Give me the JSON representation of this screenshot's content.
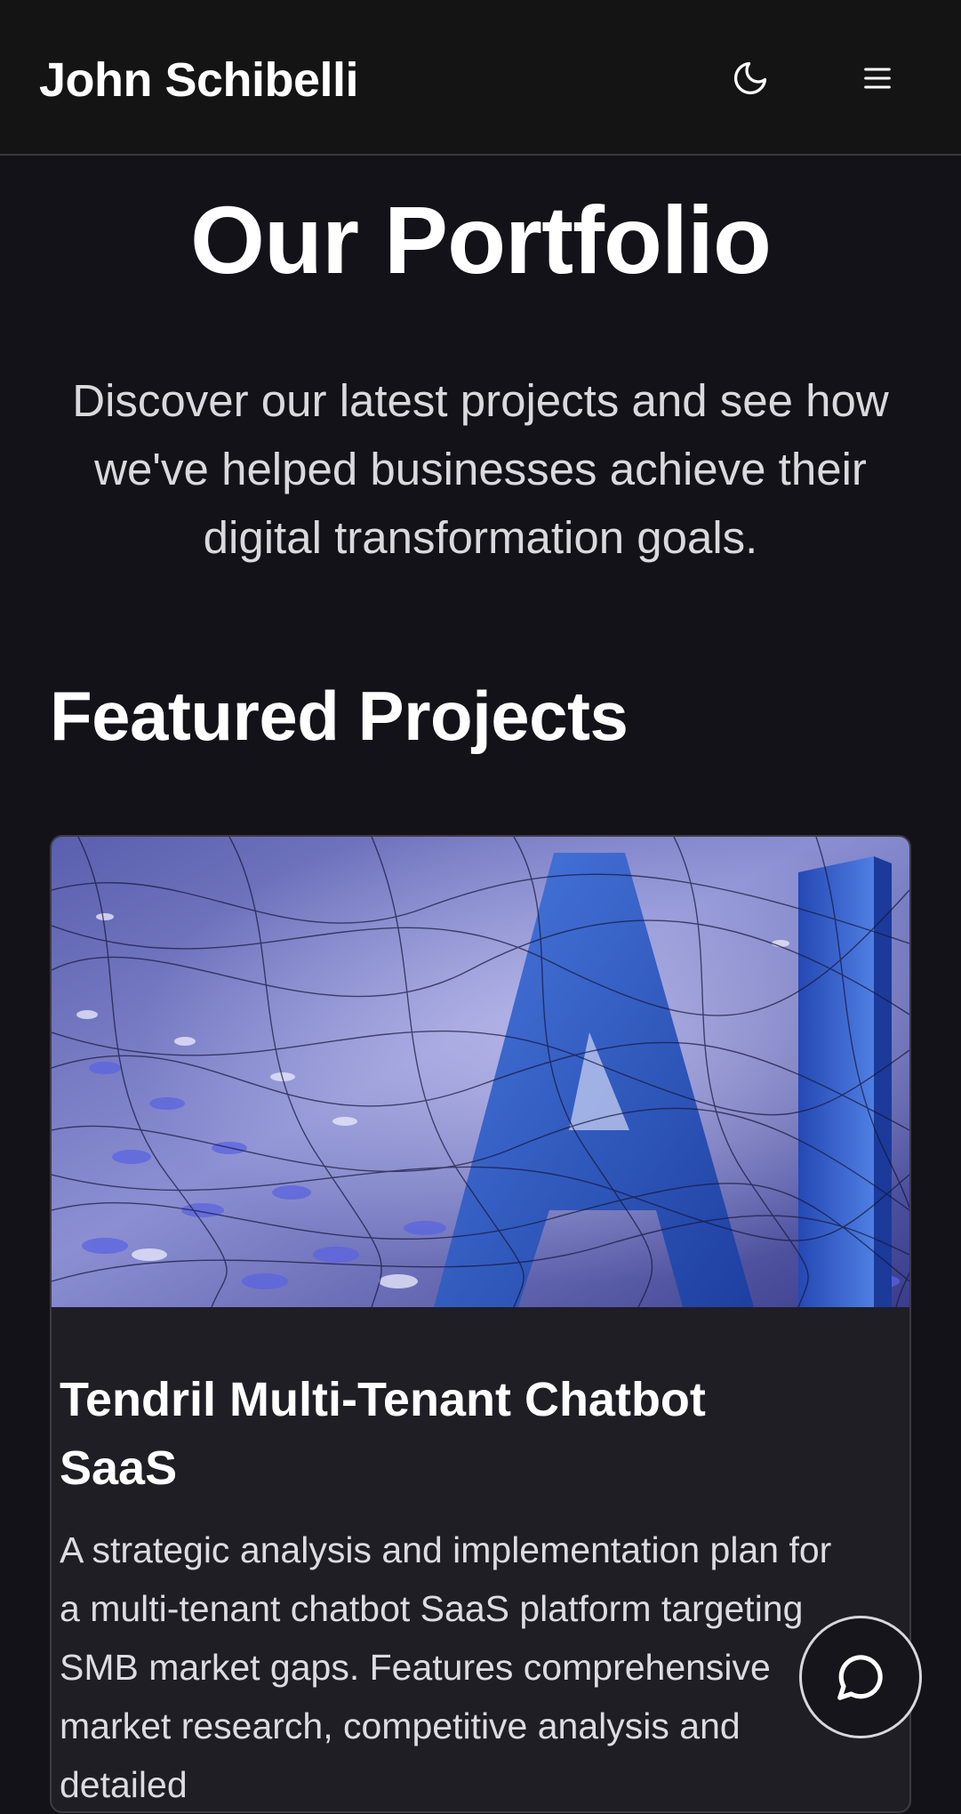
{
  "header": {
    "brand": "John Schibelli",
    "theme_toggle_icon": "moon-icon",
    "menu_icon": "hamburger-menu-icon"
  },
  "hero": {
    "title": "Our Portfolio",
    "subtitle": "Discover our latest projects and see how we've helped businesses achieve their digital transformation goals."
  },
  "featured": {
    "heading": "Featured Projects",
    "projects": [
      {
        "image_alt": "AI",
        "title": "Tendril Multi-Tenant Chatbot SaaS",
        "description": "A strategic analysis and implementation plan for a multi-tenant chatbot SaaS platform targeting SMB market gaps. Features comprehensive market research, competitive analysis and detailed"
      }
    ]
  },
  "chat_widget": {
    "icon": "chat-bubble-icon"
  },
  "colors": {
    "background": "#131218",
    "header": "#141414",
    "card": "#1f1e25",
    "text": "#ffffff",
    "muted_text": "#d9d9de",
    "image_blue": "#2a52c0"
  }
}
